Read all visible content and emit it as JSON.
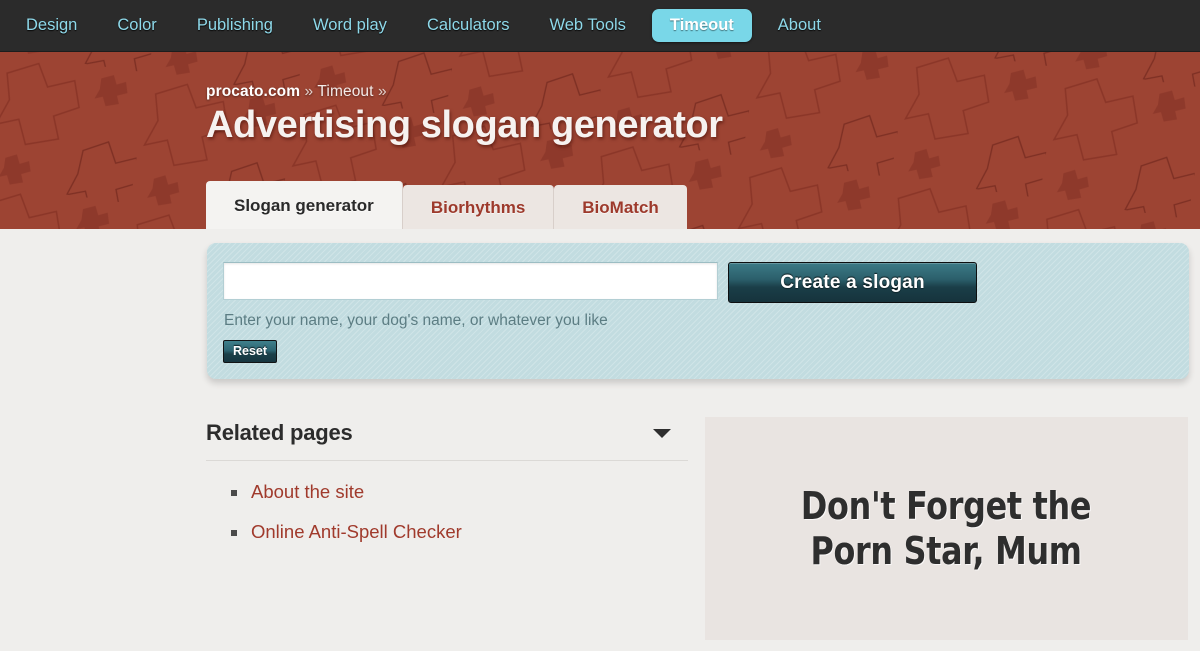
{
  "nav": {
    "items": [
      {
        "label": "Design",
        "active": false
      },
      {
        "label": "Color",
        "active": false
      },
      {
        "label": "Publishing",
        "active": false
      },
      {
        "label": "Word play",
        "active": false
      },
      {
        "label": "Calculators",
        "active": false
      },
      {
        "label": "Web Tools",
        "active": false
      },
      {
        "label": "Timeout",
        "active": true
      },
      {
        "label": "About",
        "active": false
      }
    ]
  },
  "header": {
    "breadcrumb": {
      "site": "procato.com",
      "sep1": "»",
      "section": "Timeout",
      "sep2": "»"
    },
    "title": "Advertising slogan generator",
    "background_color": "#9d4433"
  },
  "tabs": [
    {
      "label": "Slogan generator",
      "active": true
    },
    {
      "label": "Biorhythms",
      "active": false
    },
    {
      "label": "BioMatch",
      "active": false
    }
  ],
  "form": {
    "input_value": "",
    "input_placeholder": "",
    "submit_label": "Create a slogan",
    "help_text": "Enter your name, your dog's name, or whatever you like",
    "reset_label": "Reset",
    "panel_color": "#c2dce0"
  },
  "related": {
    "title": "Related pages",
    "toggle_icon": "chevron-down-icon",
    "links": [
      {
        "label": "About the site"
      },
      {
        "label": "Online Anti-Spell Checker"
      }
    ]
  },
  "slogan": {
    "line1": "Don't Forget the",
    "line2": "Porn Star, Mum",
    "panel_color": "#e9e4e1",
    "text_color": "#2e2e2e"
  }
}
